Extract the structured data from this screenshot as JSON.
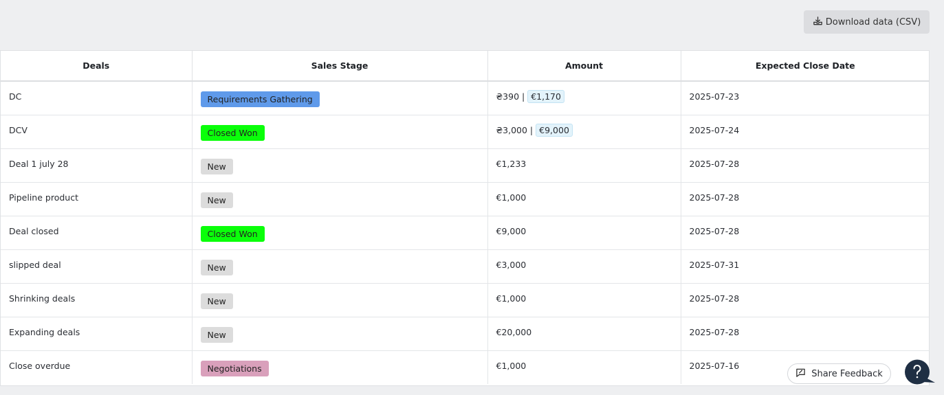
{
  "toolbar": {
    "download_label": "Download data (CSV)",
    "download_icon": "download-tray-icon"
  },
  "table": {
    "columns": [
      "Deals",
      "Sales Stage",
      "Amount",
      "Expected Close Date"
    ],
    "rows": [
      {
        "deal": "DC",
        "stage": "Requirements Gathering",
        "stage_color": "#5f9aea",
        "amount": "₴390 |",
        "converted": "€1,170",
        "close_date": "2025-07-23"
      },
      {
        "deal": "DCV",
        "stage": "Closed Won",
        "stage_color": "#0aff0a",
        "amount": "₴3,000 |",
        "converted": "€9,000",
        "close_date": "2025-07-24"
      },
      {
        "deal": "Deal 1 july 28",
        "stage": "New",
        "stage_color": "#dcdcdc",
        "amount": "€1,233",
        "converted": null,
        "close_date": "2025-07-28"
      },
      {
        "deal": "Pipeline product",
        "stage": "New",
        "stage_color": "#dcdcdc",
        "amount": "€1,000",
        "converted": null,
        "close_date": "2025-07-28"
      },
      {
        "deal": "Deal closed",
        "stage": "Closed Won",
        "stage_color": "#0aff0a",
        "amount": "€9,000",
        "converted": null,
        "close_date": "2025-07-28"
      },
      {
        "deal": "slipped deal",
        "stage": "New",
        "stage_color": "#dcdcdc",
        "amount": "€3,000",
        "converted": null,
        "close_date": "2025-07-31"
      },
      {
        "deal": "Shrinking deals",
        "stage": "New",
        "stage_color": "#dcdcdc",
        "amount": "€1,000",
        "converted": null,
        "close_date": "2025-07-28"
      },
      {
        "deal": "Expanding deals",
        "stage": "New",
        "stage_color": "#dcdcdc",
        "amount": "€20,000",
        "converted": null,
        "close_date": "2025-07-28"
      },
      {
        "deal": "Close overdue",
        "stage": "Negotiations",
        "stage_color": "#d9a0bb",
        "amount": "€1,000",
        "converted": null,
        "close_date": "2025-07-16"
      }
    ]
  },
  "feedback": {
    "label": "Share Feedback",
    "icon": "feedback-chat-icon"
  },
  "help": {
    "icon": "help-question-icon",
    "color": "#1f2f44"
  }
}
